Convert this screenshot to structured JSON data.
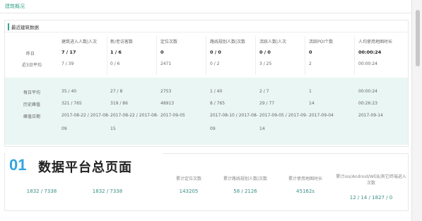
{
  "header": {
    "title": "建筑概况"
  },
  "card1": {
    "title": "最近建筑数据",
    "columns": [
      "建筑进入人数|人次",
      "新/老访客数",
      "定位次数",
      "路线规划人数|次数",
      "活跃人数|人次",
      "活跃POI个数",
      "人均使用地图时长"
    ],
    "rows": [
      {
        "label": "昨日",
        "values": [
          "7 / 17",
          "1 / 6",
          "0",
          "0 / 0",
          "0 / 0",
          "0",
          "00:00:24"
        ]
      },
      {
        "label": "近3日平均",
        "values": [
          "7 / 39",
          "0 / 6",
          "2471",
          "0 / 2",
          "3 / 25",
          "2",
          "00:00:24"
        ]
      },
      {
        "label": "每日平均",
        "values": [
          "35 / 40",
          "27 / 8",
          "2753",
          "1 / 40",
          "2 / 7",
          "1",
          "00:00:24"
        ]
      },
      {
        "label": "历史峰值",
        "values": [
          "321 / 765",
          "319 / 86",
          "48913",
          "8 / 765",
          "29 / 77",
          "14",
          "00:26:23"
        ]
      }
    ],
    "peak_date": {
      "label": "峰值日期",
      "values": [
        [
          "2017-08-22 / 2017-08-",
          "09"
        ],
        [
          "2017-08-22 / 2017-08-",
          "15"
        ],
        [
          "2017-09-05",
          ""
        ],
        [
          "2017-08-10 / 2017-08-",
          "09"
        ],
        [
          "2017-09-05 / 2017-09-",
          "14"
        ],
        [
          "2017-09-04",
          ""
        ],
        [
          "2017-09-14",
          ""
        ]
      ]
    }
  },
  "card2": {
    "labels": [
      "",
      "",
      "累计定位次数",
      "累计路线规划人数|次数",
      "累计使用地图时长",
      "累计ios/Android/WEB/其它终端进入次数"
    ],
    "values": [
      "1832 / 7338",
      "1832 / 7338",
      "143205",
      "58 / 2126",
      "45162s",
      "12 / 14 / 1827 / 0"
    ]
  },
  "banner": {
    "number": "01",
    "text": "数据平台总页面"
  }
}
